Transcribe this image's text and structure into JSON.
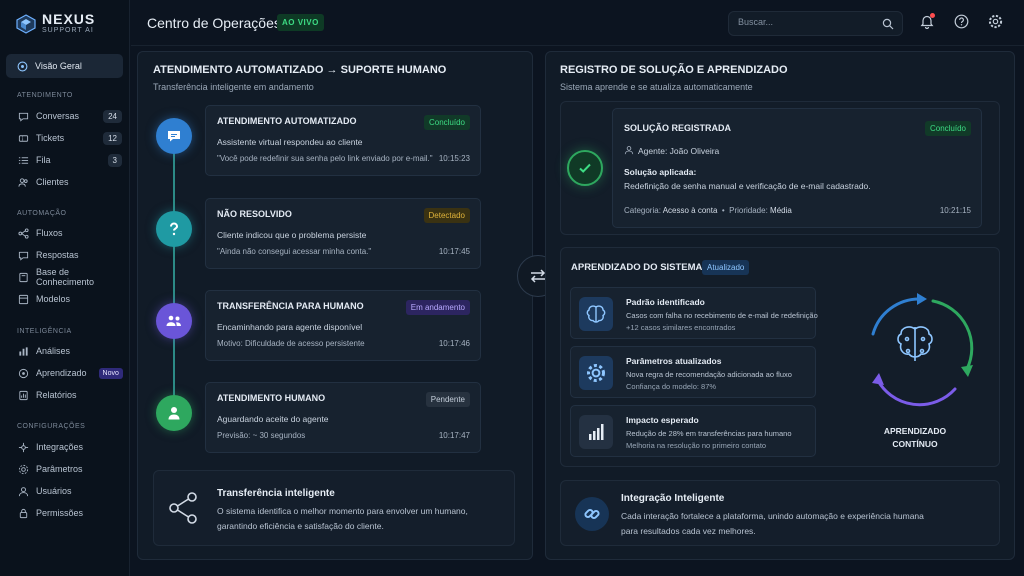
{
  "brand": {
    "name": "NEXUS",
    "subtitle": "SUPPORT AI"
  },
  "header": {
    "title": "Centro de Operações",
    "live_label": "AO VIVO",
    "search_placeholder": "Buscar..."
  },
  "sidebar": {
    "active": {
      "label": "Visão Geral",
      "icon": "grid-icon"
    },
    "sections": [
      {
        "title": "ATENDIMENTO",
        "items": [
          {
            "label": "Conversas",
            "icon": "chat-icon",
            "count": "24"
          },
          {
            "label": "Tickets",
            "icon": "ticket-icon",
            "count": "12"
          },
          {
            "label": "Fila",
            "icon": "list-icon",
            "count": "3"
          },
          {
            "label": "Clientes",
            "icon": "users-icon"
          }
        ]
      },
      {
        "title": "AUTOMAÇÃO",
        "items": [
          {
            "label": "Fluxos",
            "icon": "flow-icon"
          },
          {
            "label": "Respostas",
            "icon": "reply-icon"
          },
          {
            "label": "Base de Conhecimento",
            "icon": "book-icon"
          },
          {
            "label": "Modelos",
            "icon": "template-icon"
          }
        ]
      },
      {
        "title": "INTELIGÊNCIA",
        "items": [
          {
            "label": "Análises",
            "icon": "bar-chart-icon"
          },
          {
            "label": "Aprendizado",
            "icon": "learning-icon",
            "badge": "Novo"
          },
          {
            "label": "Relatórios",
            "icon": "report-icon"
          }
        ]
      },
      {
        "title": "CONFIGURAÇÕES",
        "items": [
          {
            "label": "Integrações",
            "icon": "plug-icon"
          },
          {
            "label": "Parâmetros",
            "icon": "gear-icon"
          },
          {
            "label": "Usuários",
            "icon": "user-icon"
          },
          {
            "label": "Permissões",
            "icon": "lock-icon"
          }
        ]
      }
    ]
  },
  "left_panel": {
    "title": "ATENDIMENTO AUTOMATIZADO → SUPORTE HUMANO",
    "subtitle": "Transferência inteligente em andamento",
    "steps": [
      {
        "title": "ATENDIMENTO AUTOMATIZADO",
        "status": "Concluído",
        "desc": "Assistente virtual respondeu ao cliente",
        "detail": "\"Você pode redefinir sua senha pelo link enviado por e-mail.\"",
        "time": "10:15:23",
        "icon": "chat-bubble-icon",
        "color": "#2f7fd1"
      },
      {
        "title": "NÃO RESOLVIDO",
        "status": "Detectado",
        "desc": "Cliente indicou que o problema persiste",
        "detail": "\"Ainda não consegui acessar minha conta.\"",
        "time": "10:17:45",
        "icon": "question-icon",
        "color": "#1f9aa3"
      },
      {
        "title": "TRANSFERÊNCIA PARA HUMANO",
        "status": "Em andamento",
        "desc": "Encaminhando para agente disponível",
        "detail": "Motivo: Dificuldade de acesso persistente",
        "time": "10:17:46",
        "icon": "team-icon",
        "color": "#6a55d8"
      },
      {
        "title": "ATENDIMENTO HUMANO",
        "status": "Pendente",
        "desc": "Aguardando aceite do agente",
        "detail": "Previsão: ~ 30 segundos",
        "time": "10:17:47",
        "icon": "person-icon",
        "color": "#2ea85f"
      }
    ],
    "info": {
      "title": "Transferência inteligente",
      "text1": "O sistema identifica o melhor momento para envolver um humano,",
      "text2": "garantindo eficiência e satisfação do cliente."
    }
  },
  "right_panel": {
    "title": "REGISTRO DE SOLUÇÃO E APRENDIZADO",
    "subtitle": "Sistema aprende e se atualiza automaticamente",
    "solution": {
      "title": "SOLUÇÃO REGISTRADA",
      "status": "Concluído",
      "agent": "Agente: João Oliveira",
      "applied_label": "Solução aplicada:",
      "applied_text": "Redefinição de senha manual e verificação de e-mail cadastrado.",
      "category_label": "Categoria:",
      "category_value": "Acesso à conta",
      "priority_label": "Prioridade:",
      "priority_value": "Média",
      "time": "10:21:15"
    },
    "learning": {
      "title": "APRENDIZADO DO SISTEMA",
      "status": "Atualizado",
      "items": [
        {
          "title": "Padrão identificado",
          "l1": "Casos com falha no recebimento de e-mail de redefinição",
          "l2": "+12 casos similares encontrados",
          "icon": "brain-icon"
        },
        {
          "title": "Parâmetros atualizados",
          "l1": "Nova regra de recomendação adicionada ao fluxo",
          "l2": "Confiança do modelo: 87%",
          "icon": "gear-icon"
        },
        {
          "title": "Impacto esperado",
          "l1": "Redução de 28% em transferências para humano",
          "l2": "Melhoria na resolução no primeiro contato",
          "icon": "bar-chart-icon"
        }
      ],
      "cycle_label1": "APRENDIZADO",
      "cycle_label2": "CONTÍNUO"
    },
    "integration": {
      "title": "Integração Inteligente",
      "text1": "Cada interação fortalece a plataforma, unindo automação e experiência humana",
      "text2": "para resultados cada vez melhores."
    }
  },
  "colors": {
    "success": "#3ddc84",
    "warning": "#e0b33a",
    "purple": "#a99bff",
    "accent": "#2f7fd1"
  }
}
